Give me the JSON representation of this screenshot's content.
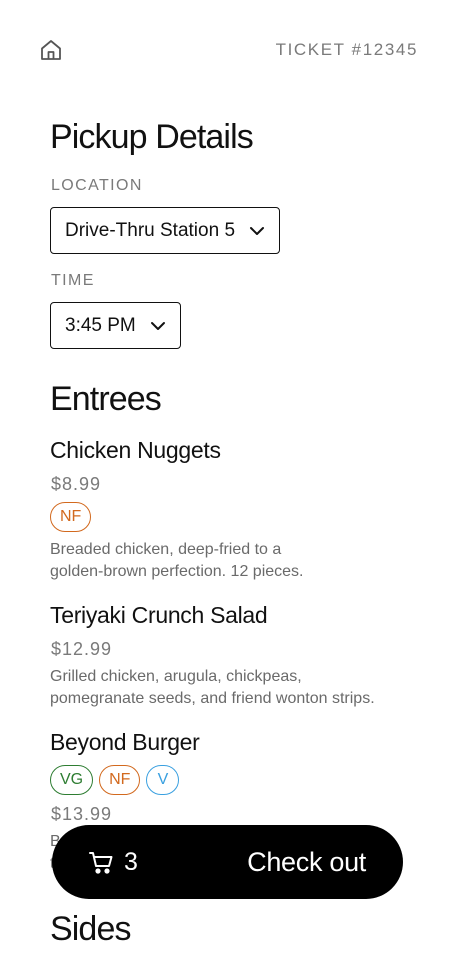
{
  "header": {
    "home_icon": "home-icon",
    "ticket": "TICKET #12345"
  },
  "pickup": {
    "title": "Pickup Details",
    "location_label": "LOCATION",
    "location_value": "Drive-Thru Station 5",
    "time_label": "TIME",
    "time_value": "3:45 PM"
  },
  "entrees": {
    "title": "Entrees",
    "items": [
      {
        "name": "Chicken Nuggets",
        "price": "$8.99",
        "badges": [
          "NF"
        ],
        "desc_line1": "Breaded chicken, deep-fried to a",
        "desc_line2": "golden-brown perfection. 12 pieces."
      },
      {
        "name": "Teriyaki Crunch Salad",
        "price": "$12.99",
        "desc_line1": "Grilled chicken, arugula, chickpeas,",
        "desc_line2": "pomegranate seeds, and friend wonton strips."
      },
      {
        "name": "Beyond Burger",
        "badges": [
          "VG",
          "NF",
          "V"
        ],
        "price": "$13.99",
        "desc_partial1": "B",
        "desc_partial2": "t"
      }
    ]
  },
  "sides": {
    "title": "Sides"
  },
  "checkout": {
    "cart_icon": "cart-icon",
    "cart_count": "3",
    "label": "Check out"
  },
  "colors": {
    "vg_badge": "#2e7d32",
    "nf_badge": "#d2691e",
    "v_badge": "#3aa0e0",
    "muted_text": "#7a7a7a",
    "checkout_bg": "#000000"
  }
}
